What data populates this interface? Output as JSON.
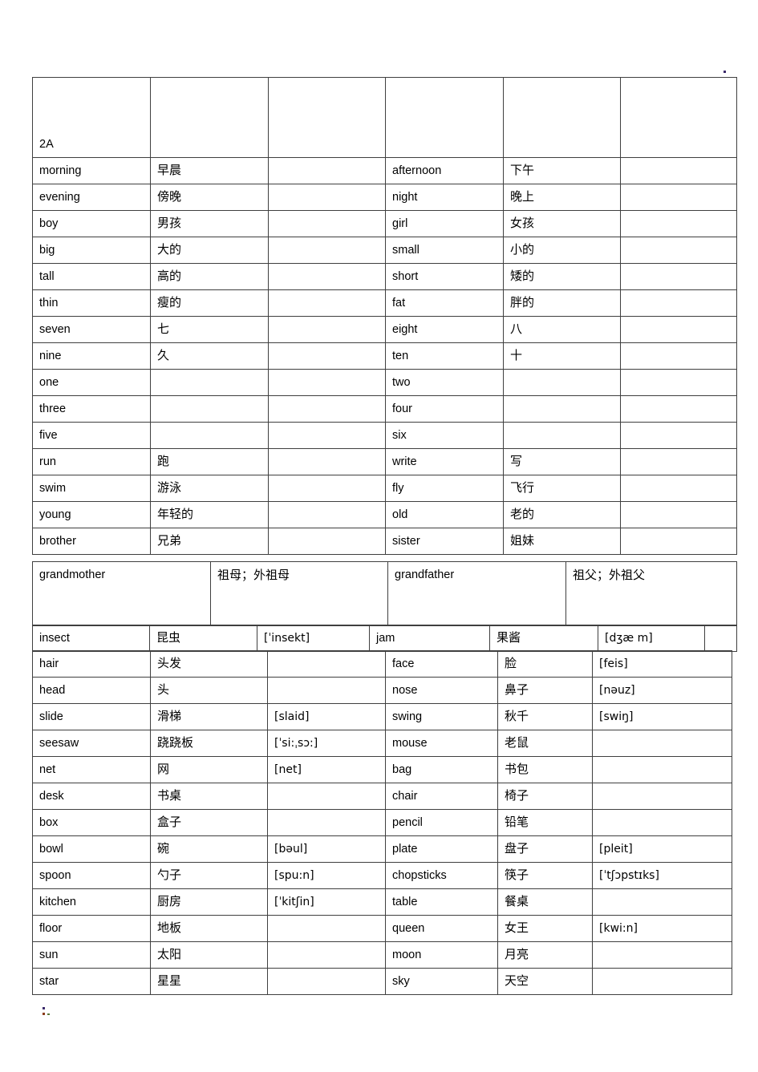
{
  "document": {
    "label": "2A",
    "section_a": {
      "header_row": [
        "2A",
        "",
        "",
        "",
        "",
        ""
      ],
      "rows": [
        {
          "en_left": "morning",
          "cn_left": "早晨",
          "ipa_left": "",
          "en_right": "afternoon",
          "cn_right": "下午",
          "ipa_right": ""
        },
        {
          "en_left": "evening",
          "cn_left": "傍晚",
          "ipa_left": "",
          "en_right": "night",
          "cn_right": "晚上",
          "ipa_right": ""
        },
        {
          "en_left": "boy",
          "cn_left": "男孩",
          "ipa_left": "",
          "en_right": "girl",
          "cn_right": "女孩",
          "ipa_right": ""
        },
        {
          "en_left": "big",
          "cn_left": "大的",
          "ipa_left": "",
          "en_right": "small",
          "cn_right": "小的",
          "ipa_right": ""
        },
        {
          "en_left": "tall",
          "cn_left": "高的",
          "ipa_left": "",
          "en_right": "short",
          "cn_right": "矮的",
          "ipa_right": ""
        },
        {
          "en_left": "thin",
          "cn_left": "瘦的",
          "ipa_left": "",
          "en_right": "fat",
          "cn_right": "胖的",
          "ipa_right": ""
        },
        {
          "en_left": "seven",
          "cn_left": "七",
          "ipa_left": "",
          "en_right": "eight",
          "cn_right": "八",
          "ipa_right": ""
        },
        {
          "en_left": "nine",
          "cn_left": "久",
          "ipa_left": "",
          "en_right": "ten",
          "cn_right": "十",
          "ipa_right": ""
        },
        {
          "en_left": "one",
          "cn_left": "",
          "ipa_left": "",
          "en_right": "two",
          "cn_right": "",
          "ipa_right": ""
        },
        {
          "en_left": "three",
          "cn_left": "",
          "ipa_left": "",
          "en_right": "four",
          "cn_right": "",
          "ipa_right": ""
        },
        {
          "en_left": "five",
          "cn_left": "",
          "ipa_left": "",
          "en_right": "six",
          "cn_right": "",
          "ipa_right": ""
        },
        {
          "en_left": "run",
          "cn_left": "跑",
          "ipa_left": "",
          "en_right": "write",
          "cn_right": "写",
          "ipa_right": ""
        },
        {
          "en_left": "swim",
          "cn_left": "游泳",
          "ipa_left": "",
          "en_right": "fly",
          "cn_right": "飞行",
          "ipa_right": ""
        },
        {
          "en_left": "young",
          "cn_left": "年轻的",
          "ipa_left": "",
          "en_right": "old",
          "cn_right": "老的",
          "ipa_right": ""
        },
        {
          "en_left": "brother",
          "cn_left": "兄弟",
          "ipa_left": "",
          "en_right": "sister",
          "cn_right": "姐妹",
          "ipa_right": ""
        }
      ]
    },
    "section_b": {
      "rows": [
        {
          "en_left": "grandmother",
          "cn_left": "祖母；外祖母",
          "en_right": "grandfather",
          "cn_right": "祖父；外祖父"
        }
      ]
    },
    "section_c": {
      "rows": [
        {
          "en_left": "insect",
          "cn_left": "昆虫",
          "ipa_left": "[ˈinsekt]",
          "en_right": "jam",
          "cn_right": "果酱",
          "ipa_right": "[dʒæ m]",
          "extra": ""
        }
      ]
    },
    "section_d": {
      "rows": [
        {
          "en_left": "hair",
          "cn_left": "头发",
          "ipa_left": "",
          "en_right": "face",
          "cn_right": "脸",
          "ipa_right": "[feis]"
        },
        {
          "en_left": "head",
          "cn_left": "头",
          "ipa_left": "",
          "en_right": "nose",
          "cn_right": "鼻子",
          "ipa_right": "[nəuz]"
        },
        {
          "en_left": "slide",
          "cn_left": "滑梯",
          "ipa_left": "[slaid]",
          "en_right": "swing",
          "cn_right": "秋千",
          "ipa_right": "[swiŋ]"
        },
        {
          "en_left": "seesaw",
          "cn_left": "跷跷板",
          "ipa_left": "[ˈsi:ˌsɔ:]",
          "en_right": "mouse",
          "cn_right": "老鼠",
          "ipa_right": ""
        },
        {
          "en_left": "net",
          "cn_left": "网",
          "ipa_left": "[net]",
          "en_right": "bag",
          "cn_right": "书包",
          "ipa_right": ""
        },
        {
          "en_left": "desk",
          "cn_left": "书桌",
          "ipa_left": "",
          "en_right": "chair",
          "cn_right": "椅子",
          "ipa_right": ""
        },
        {
          "en_left": "box",
          "cn_left": "盒子",
          "ipa_left": "",
          "en_right": "pencil",
          "cn_right": "铅笔",
          "ipa_right": ""
        },
        {
          "en_left": "bowl",
          "cn_left": "碗",
          "ipa_left": "[bəul]",
          "en_right": "plate",
          "cn_right": "盘子",
          "ipa_right": "[pleit]"
        },
        {
          "en_left": "spoon",
          "cn_left": "勺子",
          "ipa_left": "[spu:n]",
          "en_right": "chopsticks",
          "cn_right": "筷子",
          "ipa_right": "[ˈtʃɔpstɪks]"
        },
        {
          "en_left": "kitchen",
          "cn_left": "厨房",
          "ipa_left": "[ˈkitʃin]",
          "en_right": "table",
          "cn_right": "餐桌",
          "ipa_right": ""
        },
        {
          "en_left": "floor",
          "cn_left": "地板",
          "ipa_left": "",
          "en_right": "queen",
          "cn_right": "女王",
          "ipa_right": "[kwi:n]"
        },
        {
          "en_left": "sun",
          "cn_left": "太阳",
          "ipa_left": "",
          "en_right": "moon",
          "cn_right": "月亮",
          "ipa_right": ""
        },
        {
          "en_left": "star",
          "cn_left": "星星",
          "ipa_left": "",
          "en_right": "sky",
          "cn_right": "天空",
          "ipa_right": ""
        }
      ]
    }
  }
}
